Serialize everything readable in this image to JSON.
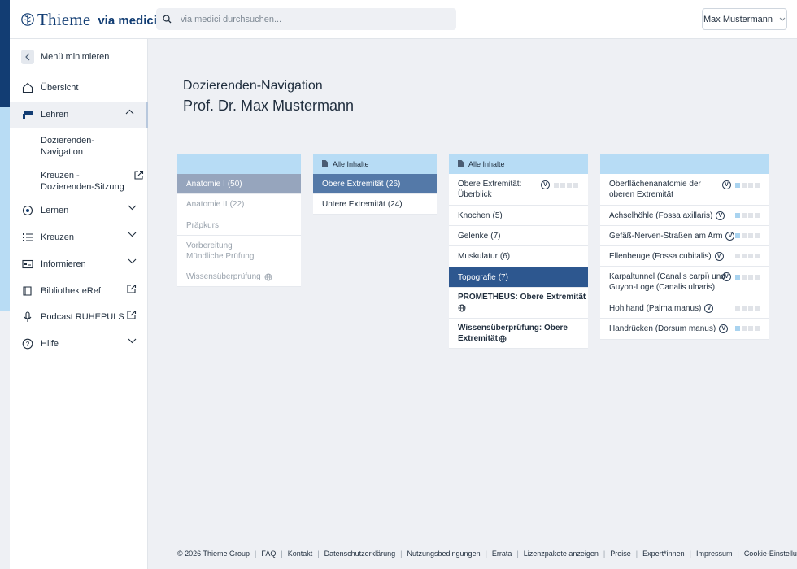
{
  "header": {
    "logo_thieme": "Thieme",
    "logo_via": "via medici",
    "search_placeholder": "via medici durchsuchen...",
    "user_name": "Max Mustermann"
  },
  "sidebar": {
    "minimize_label": "Menü minimieren",
    "items": [
      {
        "label": "Übersicht",
        "icon": "home-icon"
      },
      {
        "label": "Lehren",
        "icon": "teacher-icon"
      },
      {
        "label": "Lernen",
        "icon": "learn-icon"
      },
      {
        "label": "Kreuzen",
        "icon": "list-icon"
      },
      {
        "label": "Informieren",
        "icon": "news-icon"
      },
      {
        "label": "Bibliothek eRef",
        "icon": "book-icon"
      },
      {
        "label": "Podcast RUHEPULS",
        "icon": "microphone-icon"
      },
      {
        "label": "Hilfe",
        "icon": "help-icon"
      }
    ],
    "subitems": [
      {
        "label": "Dozierenden-\nNavigation"
      },
      {
        "label": "Kreuzen -\nDozierenden-Sitzung"
      }
    ]
  },
  "main": {
    "title": "Dozierenden-Navigation",
    "subtitle": "Prof. Dr. Max Mustermann"
  },
  "columns": {
    "col1": {
      "rows": [
        {
          "label": "Anatomie I",
          "count": "(50)"
        },
        {
          "label": "Anatomie II",
          "count": "(22)"
        },
        {
          "label": "Präpkurs",
          "count": ""
        },
        {
          "label": "Vorbereitung\nMündliche Prüfung",
          "count": ""
        },
        {
          "label": "Wissensüberprüfung",
          "count": ""
        }
      ]
    },
    "col2": {
      "header": "Alle Inhalte",
      "rows": [
        {
          "label": "Obere Extremität",
          "count": "(26)"
        },
        {
          "label": "Untere Extremität",
          "count": "(24)"
        }
      ]
    },
    "col3": {
      "header": "Alle Inhalte",
      "rows": [
        {
          "label": "Obere Extremität:\nÜberblick",
          "count": "",
          "badge": "V",
          "progress": 0
        },
        {
          "label": "Knochen",
          "count": "(5)"
        },
        {
          "label": "Gelenke",
          "count": "(7)"
        },
        {
          "label": "Muskulatur",
          "count": "(6)"
        },
        {
          "label": "Topografie",
          "count": "(7)"
        },
        {
          "label": "PROMETHEUS: Obere Extremität",
          "count": ""
        },
        {
          "label": "Wissensüberprüfung: Obere\nExtremität",
          "count": ""
        }
      ]
    },
    "col4": {
      "rows": [
        {
          "label": "Oberflächenanatomie der\noberen Extremität",
          "badge": "V",
          "progress": 1
        },
        {
          "label": "Achselhöhle (Fossa axillaris)",
          "badge": "V",
          "progress": 1
        },
        {
          "label": "Gefäß-Nerven-Straßen am Arm",
          "badge": "V",
          "progress": 1
        },
        {
          "label": "Ellenbeuge (Fossa cubitalis)",
          "badge": "V",
          "progress": 0
        },
        {
          "label": "Karpaltunnel (Canalis carpi) und\nGuyon-Loge (Canalis ulnaris)",
          "badge": "V",
          "progress": 1
        },
        {
          "label": "Hohlhand (Palma manus)",
          "badge": "V",
          "progress": 0
        },
        {
          "label": "Handrücken (Dorsum manus)",
          "badge": "V",
          "progress": 1
        }
      ]
    }
  },
  "footer": {
    "copyright": "© 2026 Thieme Group",
    "links": [
      "FAQ",
      "Kontakt",
      "Datenschutzerklärung",
      "Nutzungsbedingungen",
      "Errata",
      "Lizenzpakete anzeigen",
      "Preise",
      "Expert*innen",
      "Impressum",
      "Cookie-Einstellungen"
    ]
  },
  "colors": {
    "brand_dark": "#123d73",
    "brand_light": "#b7dcf5",
    "selected_1": "#96a5bd",
    "selected_2": "#5479a8",
    "selected_3": "#2d578f"
  }
}
